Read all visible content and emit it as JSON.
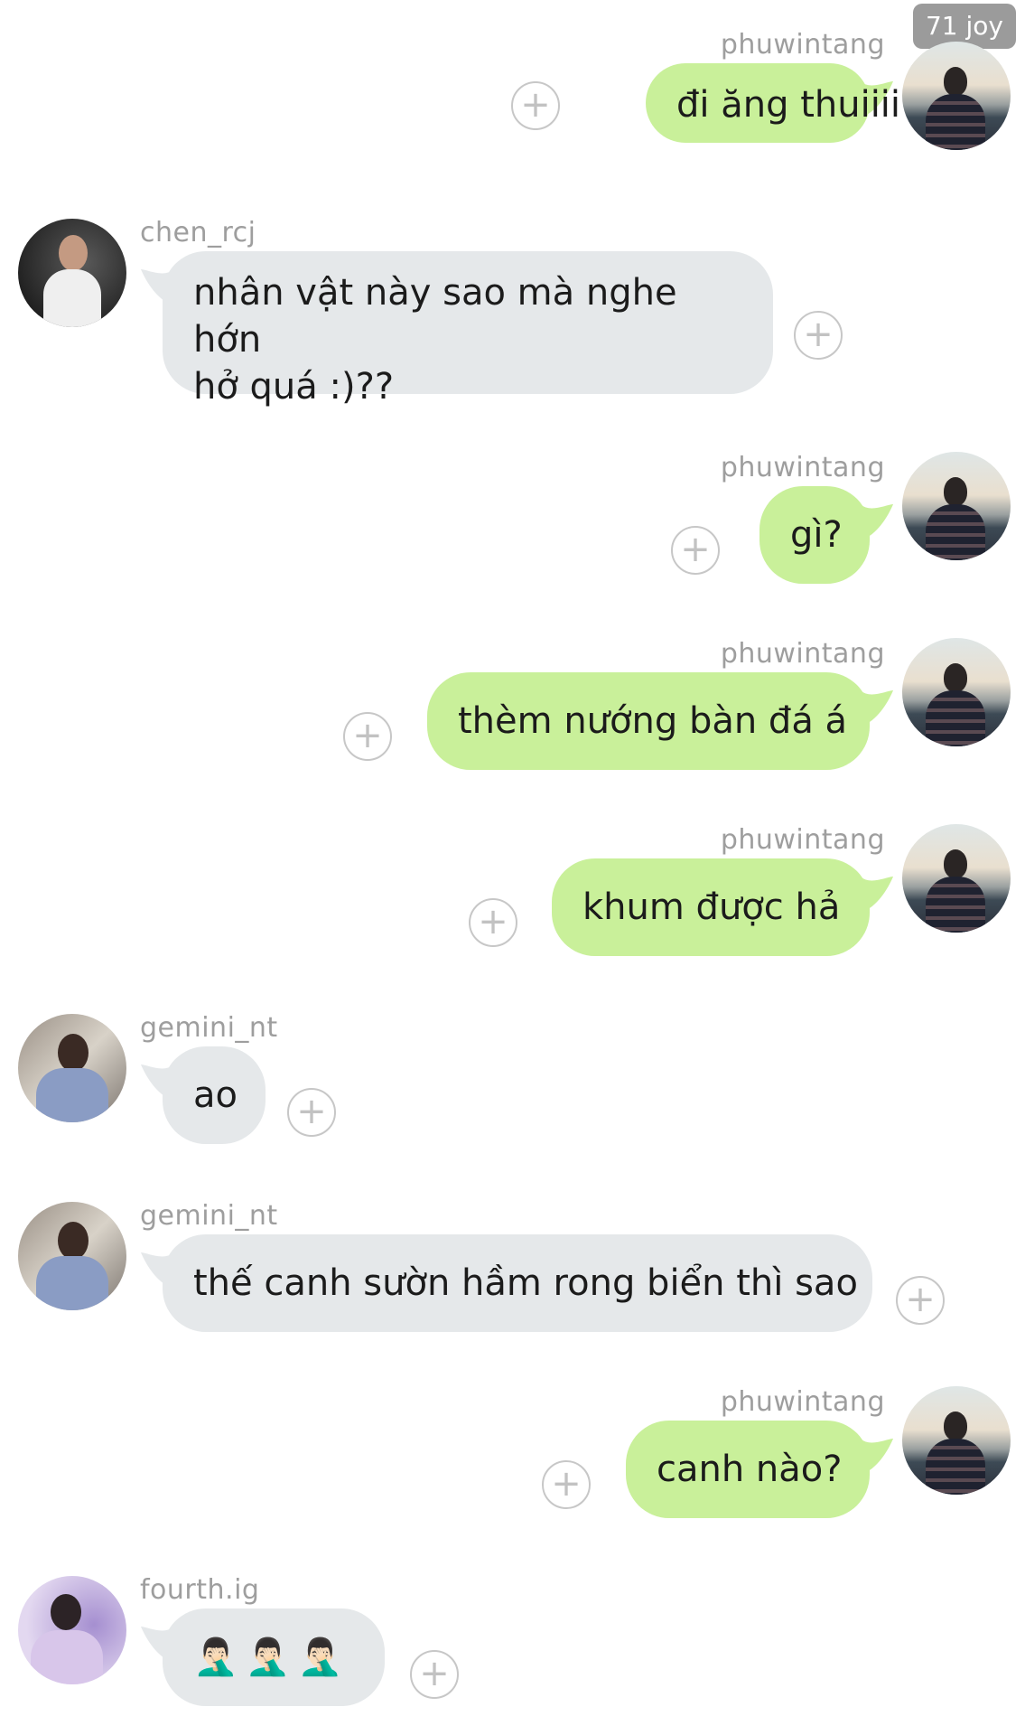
{
  "watermark": "71 joy",
  "colors": {
    "sent_bubble": "#c9f09a",
    "received_bubble": "#e5e8ea",
    "username": "#9e9e9e"
  },
  "messages": [
    {
      "sender": "phuwintang",
      "text": "đi ăng thuiiii",
      "side": "right",
      "avatar": "avatar-photo"
    },
    {
      "sender": "chen_rcj",
      "text": "nhân vật này sao mà nghe hớn",
      "text2": "hở quá :)??",
      "side": "left",
      "avatar": "avatar-photo"
    },
    {
      "sender": "phuwintang",
      "text": "gì?",
      "side": "right",
      "avatar": "avatar-photo"
    },
    {
      "sender": "phuwintang",
      "text": "thèm nướng bàn đá á",
      "side": "right",
      "avatar": "avatar-photo"
    },
    {
      "sender": "phuwintang",
      "text": "khum được hả",
      "side": "right",
      "avatar": "avatar-photo"
    },
    {
      "sender": "gemini_nt",
      "text": "ao",
      "side": "left",
      "avatar": "avatar-photo"
    },
    {
      "sender": "gemini_nt",
      "text": "thế canh sườn hầm rong biển thì sao",
      "side": "left",
      "avatar": "avatar-photo"
    },
    {
      "sender": "phuwintang",
      "text": "canh nào?",
      "side": "right",
      "avatar": "avatar-photo"
    },
    {
      "sender": "fourth.ig",
      "text": "🤦🏻‍♂️🤦🏻‍♂️🤦🏻‍♂️",
      "side": "left",
      "avatar": "avatar-photo"
    }
  ],
  "icons": {
    "reaction": "plus-circle-icon",
    "plus_glyph": "+"
  }
}
